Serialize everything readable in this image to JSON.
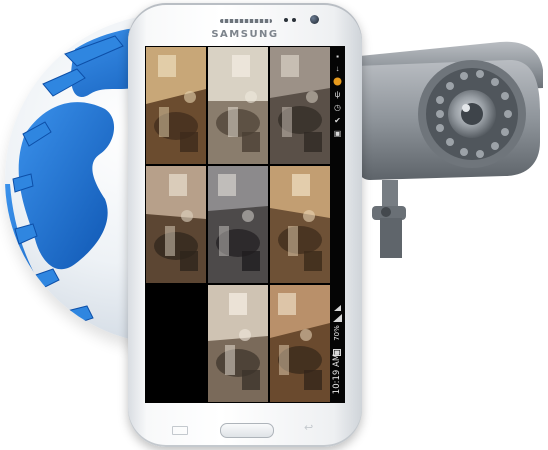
{
  "device": {
    "brand": "SAMSUNG"
  },
  "statusbar": {
    "time": "10:19 AM",
    "battery_percent": "70%",
    "icons": [
      "notification-icon",
      "download-icon",
      "app-icon",
      "usb-icon",
      "alarm-icon",
      "check-icon",
      "image-icon",
      "wifi-icon",
      "signal-icon",
      "battery-icon"
    ]
  },
  "camera_feeds": [
    {
      "name": "feed-1",
      "palette": [
        "#6b4c2f",
        "#c8a778",
        "#3d2b1b",
        "#e6d3b0"
      ]
    },
    {
      "name": "feed-2",
      "palette": [
        "#8a7d6d",
        "#d9d2c4",
        "#4a3f33",
        "#efe9de"
      ]
    },
    {
      "name": "feed-3",
      "palette": [
        "#5a5048",
        "#9c9187",
        "#2f2924",
        "#cfc6bb"
      ]
    },
    {
      "name": "feed-4",
      "palette": [
        "#5c4633",
        "#b7a08a",
        "#2e241b",
        "#e0d3c2"
      ]
    },
    {
      "name": "feed-5",
      "palette": [
        "#4d4a4a",
        "#8c8a8c",
        "#1f1d1f",
        "#c9c6c2"
      ]
    },
    {
      "name": "feed-6",
      "palette": [
        "#6e5136",
        "#c29e72",
        "#3b2a1a",
        "#e9d5b6"
      ]
    },
    {
      "name": "feed-7",
      "palette": [
        "#000000",
        "#000000",
        "#000000",
        "#000000"
      ]
    },
    {
      "name": "feed-8",
      "palette": [
        "#7a6a5a",
        "#cfc3b3",
        "#3c332a",
        "#f0e8dc"
      ]
    },
    {
      "name": "feed-9",
      "palette": [
        "#6a4a2e",
        "#b9906a",
        "#35261a",
        "#e3cfb3"
      ]
    }
  ],
  "colors": {
    "globe_ocean": "#1a6fd0",
    "globe_land": "#e9edf2",
    "camera_body": "#8e949a",
    "phone_body": "#f7f8f9"
  }
}
